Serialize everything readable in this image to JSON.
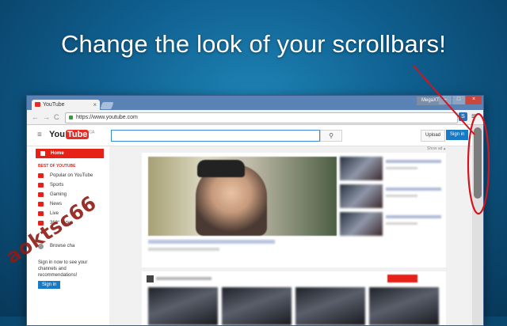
{
  "headline": "Change the look of your scrollbars!",
  "browser": {
    "tab_title": "YouTube",
    "tab_close": "×",
    "user_badge": "MegaXT",
    "window_controls": {
      "minimize": "–",
      "maximize": "□",
      "close": "×"
    },
    "url": "https://www.youtube.com",
    "back": "←",
    "forward": "→",
    "reload": "C",
    "menu_glyph": "≡",
    "extension_glyph": "S"
  },
  "youtube": {
    "logo_you": "You",
    "logo_tube": "Tube",
    "logo_region": "CA",
    "search_glyph": "⚲",
    "upload_label": "Upload",
    "signin_label": "Sign in",
    "hamburger_glyph": "≡",
    "show_ad": "Show ad ▴",
    "sidebar": {
      "home": "Home",
      "heading": "BEST OF YOUTUBE",
      "items": [
        {
          "label": "Popular on YouTube",
          "icon": "popular-icon"
        },
        {
          "label": "Sports",
          "icon": "sports-icon"
        },
        {
          "label": "Gaming",
          "icon": "gaming-icon"
        },
        {
          "label": "News",
          "icon": "news-icon"
        },
        {
          "label": "Live",
          "icon": "live-icon"
        },
        {
          "label": "360° Video",
          "icon": "360-video-icon"
        }
      ],
      "browse_channels": "Browse cha",
      "signin_note": "Sign in now to see your channels and recommendations!",
      "signin_button": "Sign in"
    }
  },
  "watermark": "aoktsc66",
  "colors": {
    "annotation_red": "#d4141c",
    "youtube_red": "#e62117",
    "signin_blue": "#167ac6"
  }
}
